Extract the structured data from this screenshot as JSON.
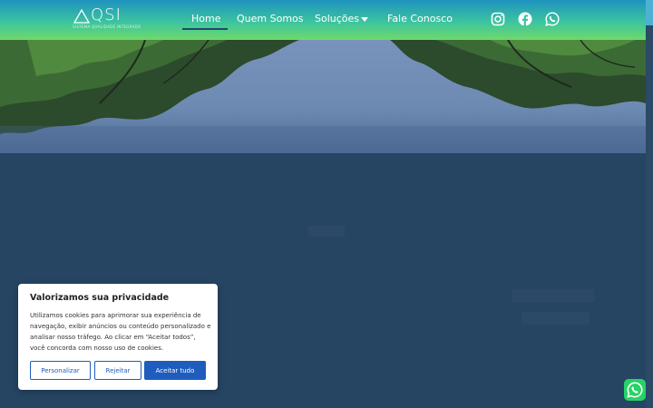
{
  "brand": {
    "name": "QSI",
    "tagline": "SISTEMA QUALIDADE INTEGRADO"
  },
  "nav": {
    "items": [
      {
        "label": "Home"
      },
      {
        "label": "Quem Somos"
      },
      {
        "label": "Soluções"
      },
      {
        "label": "Fale Conosco"
      }
    ],
    "active": "Home"
  },
  "social": [
    "instagram-icon",
    "facebook-icon",
    "whatsapp-icon"
  ],
  "cookie": {
    "title": "Valorizamos sua privacidade",
    "text": "Utilizamos cookies para aprimorar sua experiência de navegação, exibir anúncios ou conteúdo personalizado e analisar nosso tráfego. Ao clicar em “Aceitar todos”, você concorda com nosso uso de cookies.",
    "buttons": {
      "customize": "Personalizar",
      "reject": "Rejeitar",
      "accept": "Aceitar tudo"
    }
  },
  "colors": {
    "nav_gradient_top": "#1e93bf",
    "nav_gradient_bottom": "#6fd96b",
    "content_bg": "#264563",
    "button_blue": "#1e5dbd",
    "whatsapp_green": "#25d366"
  }
}
